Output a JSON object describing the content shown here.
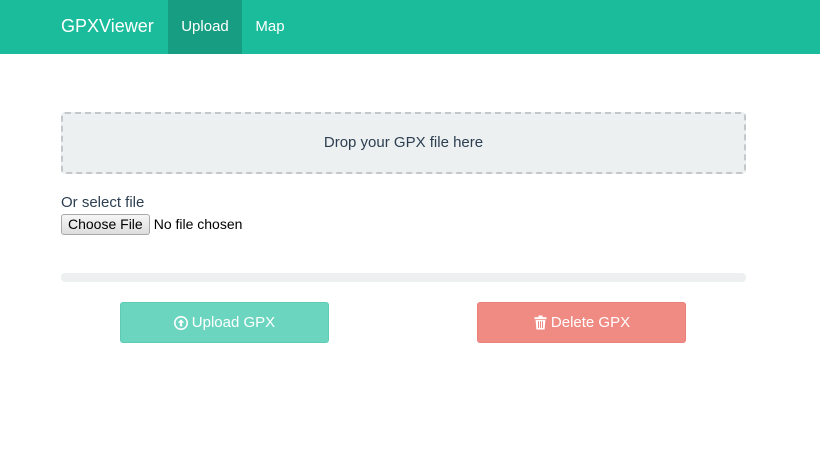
{
  "navbar": {
    "brand": "GPXViewer",
    "items": [
      {
        "label": "Upload",
        "active": true
      },
      {
        "label": "Map",
        "active": false
      }
    ],
    "color": "#1abc9c",
    "active_color": "#179d82"
  },
  "dropzone": {
    "text": "Drop your GPX file here"
  },
  "file_select": {
    "label": "Or select file",
    "button_label": "Choose File",
    "status": "No file chosen"
  },
  "progress": {
    "value": 0
  },
  "actions": {
    "upload_label": "Upload GPX",
    "upload_icon": "upload-circle-icon",
    "upload_color": "#6bd5bf",
    "delete_label": "Delete GPX",
    "delete_icon": "trash-icon",
    "delete_color": "#f08b83"
  }
}
